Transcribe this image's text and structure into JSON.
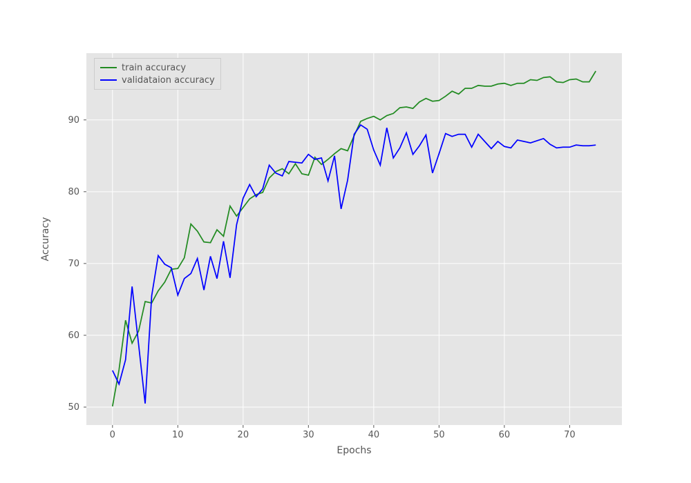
{
  "chart_data": {
    "type": "line",
    "xlabel": "Epochs",
    "ylabel": "Accuracy",
    "xlim": [
      -4,
      78
    ],
    "ylim": [
      47.5,
      99.3
    ],
    "xticks": [
      0,
      10,
      20,
      30,
      40,
      50,
      60,
      70
    ],
    "yticks": [
      50,
      60,
      70,
      80,
      90
    ],
    "legend_position": "upper-left",
    "series": [
      {
        "name": "train accuracy",
        "color": "#228b22",
        "x": [
          0,
          1,
          2,
          3,
          4,
          5,
          6,
          7,
          8,
          9,
          10,
          11,
          12,
          13,
          14,
          15,
          16,
          17,
          18,
          19,
          20,
          21,
          22,
          23,
          24,
          25,
          26,
          27,
          28,
          29,
          30,
          31,
          32,
          33,
          34,
          35,
          36,
          37,
          38,
          39,
          40,
          41,
          42,
          43,
          44,
          45,
          46,
          47,
          48,
          49,
          50,
          51,
          52,
          53,
          54,
          55,
          56,
          57,
          58,
          59,
          60,
          61,
          62,
          63,
          64,
          65,
          66,
          67,
          68,
          69,
          70,
          71,
          72,
          73,
          74
        ],
        "values": [
          50.1,
          55.2,
          62.1,
          58.9,
          60.6,
          64.7,
          64.5,
          66.2,
          67.4,
          69.2,
          69.3,
          70.8,
          75.5,
          74.5,
          73.0,
          72.9,
          74.7,
          73.8,
          78.0,
          76.6,
          77.8,
          79.0,
          79.6,
          79.9,
          81.9,
          82.8,
          83.2,
          82.5,
          83.9,
          82.5,
          82.3,
          84.8,
          83.8,
          84.5,
          85.3,
          86.0,
          85.7,
          87.8,
          89.8,
          90.2,
          90.5,
          90.0,
          90.6,
          90.9,
          91.7,
          91.8,
          91.6,
          92.5,
          93.0,
          92.6,
          92.7,
          93.3,
          94.0,
          93.6,
          94.4,
          94.4,
          94.8,
          94.7,
          94.7,
          95.0,
          95.1,
          94.8,
          95.1,
          95.1,
          95.6,
          95.5,
          95.9,
          96.0,
          95.3,
          95.2,
          95.6,
          95.7,
          95.3,
          95.3,
          96.8
        ]
      },
      {
        "name": "validataion accuracy",
        "color": "#0000ff",
        "x": [
          0,
          1,
          2,
          3,
          4,
          5,
          6,
          7,
          8,
          9,
          10,
          11,
          12,
          13,
          14,
          15,
          16,
          17,
          18,
          19,
          20,
          21,
          22,
          23,
          24,
          25,
          26,
          27,
          28,
          29,
          30,
          31,
          32,
          33,
          34,
          35,
          36,
          37,
          38,
          39,
          40,
          41,
          42,
          43,
          44,
          45,
          46,
          47,
          48,
          49,
          50,
          51,
          52,
          53,
          54,
          55,
          56,
          57,
          58,
          59,
          60,
          61,
          62,
          63,
          64,
          65,
          66,
          67,
          68,
          69,
          70,
          71,
          72,
          73,
          74
        ],
        "values": [
          55.1,
          53.2,
          56.6,
          66.8,
          58.7,
          50.5,
          65.5,
          71.1,
          69.9,
          69.4,
          65.6,
          67.9,
          68.6,
          70.7,
          66.3,
          71.0,
          67.9,
          73.1,
          68.0,
          75.4,
          79.1,
          81.0,
          79.3,
          80.4,
          83.7,
          82.6,
          82.2,
          84.2,
          84.1,
          84.0,
          85.2,
          84.5,
          84.7,
          81.5,
          85.0,
          77.6,
          81.6,
          88.0,
          89.3,
          88.7,
          85.8,
          83.7,
          88.9,
          84.7,
          86.1,
          88.2,
          85.2,
          86.4,
          87.9,
          82.6,
          85.3,
          88.1,
          87.7,
          88.0,
          88.0,
          86.2,
          88.0,
          87.0,
          86.0,
          87.0,
          86.3,
          86.1,
          87.2,
          87.0,
          86.8,
          87.1,
          87.4,
          86.6,
          86.1,
          86.2,
          86.2,
          86.5,
          86.4,
          86.4,
          86.5
        ]
      }
    ]
  }
}
